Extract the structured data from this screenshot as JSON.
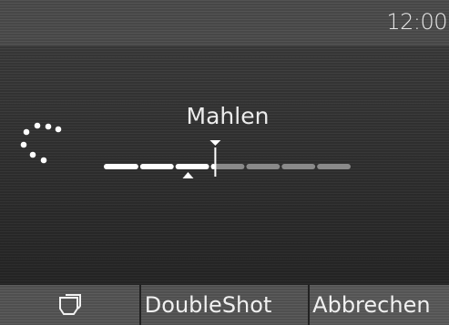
{
  "status_bar": {
    "time": "12:00"
  },
  "main": {
    "step_label": "Mahlen",
    "progress": {
      "segments_total": 7,
      "filled_segments": 3,
      "current_marker_fraction": 0.45,
      "target_marker_fraction": 0.34
    }
  },
  "softkeys": {
    "cup_icon": "cup-icon",
    "doubleshot_label": "DoubleShot",
    "cancel_label": "Abbrechen"
  },
  "colors": {
    "track_filled": "#ffffff",
    "track_empty": "#8a8a8a",
    "background": "#4a4a4a"
  }
}
